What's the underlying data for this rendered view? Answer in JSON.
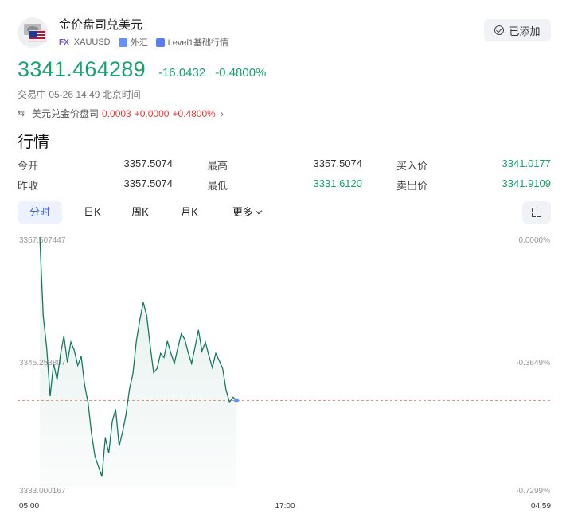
{
  "instrument": {
    "name": "金价盘司兑美元",
    "market_tag": "FX",
    "symbol": "XAUUSD",
    "category": "外汇",
    "data_level": "Level1基础行情",
    "added_label": "已添加",
    "icons": {
      "flag": "gold-us-flag-icon",
      "added": "check-circle-icon",
      "category": "forex-icon",
      "level": "level1-icon"
    }
  },
  "quote": {
    "price": "3341.464289",
    "change": "-16.0432",
    "change_pct": "-0.4800%",
    "status": "交易中 05-26 14:49 北京时间",
    "color": "#17a36b"
  },
  "inverse_pair": {
    "label": "美元兑金价盘司",
    "price": "0.0003",
    "change": "+0.0000",
    "change_pct": "+0.4800%",
    "color": "#e23b3b"
  },
  "section_title": "行情",
  "stats": {
    "open_label": "今开",
    "open": "3357.5074",
    "high_label": "最高",
    "high": "3357.5074",
    "bid_label": "买入价",
    "bid": "3341.0177",
    "prev_close_label": "昨收",
    "prev_close": "3357.5074",
    "low_label": "最低",
    "low": "3331.6120",
    "ask_label": "卖出价",
    "ask": "3341.9109"
  },
  "tabs": [
    {
      "label": "分时",
      "active": true
    },
    {
      "label": "日K",
      "active": false
    },
    {
      "label": "周K",
      "active": false
    },
    {
      "label": "月K",
      "active": false
    },
    {
      "label": "更多",
      "active": false
    }
  ],
  "chart_data": {
    "type": "line",
    "y_labels": [
      "3357.507447",
      "3345.253807",
      "3333.000167"
    ],
    "pct_labels": [
      "0.0000%",
      "-0.3649%",
      "-0.7299%"
    ],
    "x_labels": [
      "05:00",
      "17:00",
      "04:59"
    ],
    "ylim": [
      3333.000167,
      3357.507447
    ],
    "prev_close": 3357.507447,
    "current": 3341.464289,
    "line_color": "#137a5e",
    "values": [
      3357.5,
      3349.8,
      3346.6,
      3341.9,
      3345.1,
      3343.5,
      3346.0,
      3347.8,
      3345.2,
      3347.2,
      3346.4,
      3344.9,
      3345.8,
      3343.0,
      3341.2,
      3338.2,
      3336.0,
      3335.0,
      3334.0,
      3337.8,
      3336.3,
      3339.4,
      3340.6,
      3337.0,
      3338.4,
      3340.1,
      3342.6,
      3344.1,
      3347.3,
      3349.4,
      3351.1,
      3349.8,
      3346.8,
      3344.2,
      3344.6,
      3346.1,
      3345.7,
      3347.3,
      3346.1,
      3345.1,
      3346.6,
      3348.0,
      3347.5,
      3346.2,
      3345.1,
      3346.7,
      3348.4,
      3346.3,
      3347.2,
      3345.9,
      3344.7,
      3346.1,
      3345.4,
      3344.6,
      3342.5,
      3341.3,
      3341.8,
      3341.5
    ]
  }
}
